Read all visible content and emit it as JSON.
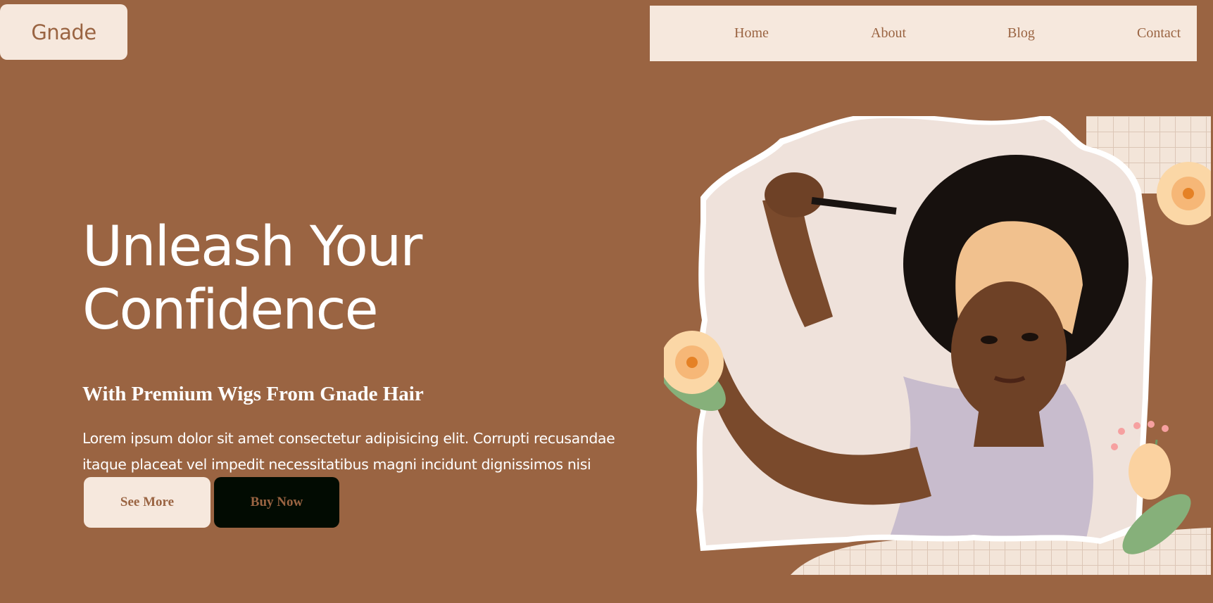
{
  "brand": {
    "name": "Gnade"
  },
  "nav": {
    "items": [
      "Home",
      "About",
      "Blog",
      "Contact"
    ]
  },
  "hero": {
    "title_line1": "Unleash Your",
    "title_line2": "Confidence",
    "subtitle": "With Premium Wigs From Gnade Hair",
    "body_line1": "Lorem ipsum dolor sit amet consectetur adipisicing elit. Corrupti recusandae",
    "body_line2": "itaque placeat vel impedit necessitatibus magni incidunt dignissimos nisi",
    "see_more_label": "See More",
    "buy_now_label": "Buy Now"
  },
  "colors": {
    "background": "#9a6442",
    "cream": "#f6e8dd",
    "dark_button": "#020b02",
    "text_light": "#ffffff"
  },
  "icons": [
    "flower-icon",
    "leaf-icon"
  ]
}
